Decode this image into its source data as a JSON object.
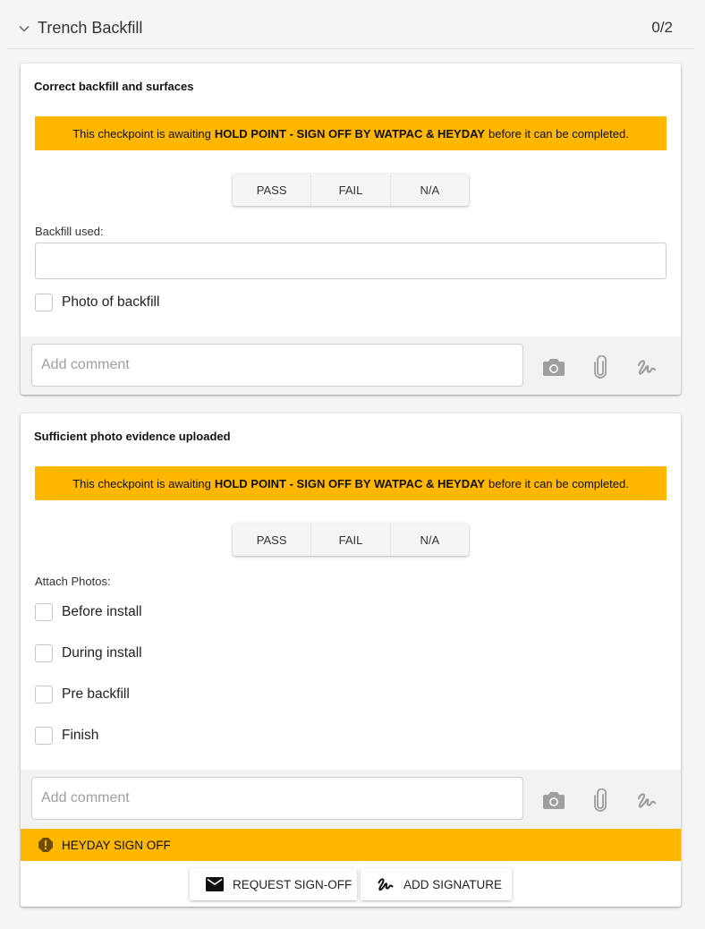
{
  "section": {
    "title": "Trench Backfill",
    "count": "0/2",
    "toggle_icon": "chevron-down-icon"
  },
  "checkpoints": [
    {
      "title": "Correct backfill and surfaces",
      "banner": {
        "prefix": "This checkpoint is awaiting",
        "strong": "HOLD POINT - SIGN OFF BY WATPAC & HEYDAY",
        "suffix": "before it can be completed."
      },
      "options": [
        "PASS",
        "FAIL",
        "N/A"
      ],
      "field_label": "Backfill used:",
      "field_value": "",
      "checkboxes": [
        "Photo of backfill"
      ],
      "comment_placeholder": "Add comment",
      "tools": [
        "camera-icon",
        "paperclip-icon",
        "signature-icon"
      ]
    },
    {
      "title": "Sufficient photo evidence uploaded",
      "banner": {
        "prefix": "This checkpoint is awaiting",
        "strong": "HOLD POINT - SIGN OFF BY WATPAC & HEYDAY",
        "suffix": "before it can be completed."
      },
      "options": [
        "PASS",
        "FAIL",
        "N/A"
      ],
      "field_label": "Attach Photos:",
      "checkboxes": [
        "Before install",
        "During install",
        "Pre backfill",
        "Finish"
      ],
      "comment_placeholder": "Add comment",
      "tools": [
        "camera-icon",
        "paperclip-icon",
        "signature-icon"
      ]
    }
  ],
  "signoff": {
    "label": "HEYDAY SIGN OFF",
    "icon": "warning-icon",
    "request_label": "REQUEST SIGN-OFF",
    "request_icon": "mail-icon",
    "signature_label": "ADD SIGNATURE",
    "signature_icon": "signature-icon"
  },
  "colors": {
    "accent": "#ffb700",
    "background": "#f5f5f5",
    "icon_gray": "#9e9e9e"
  }
}
